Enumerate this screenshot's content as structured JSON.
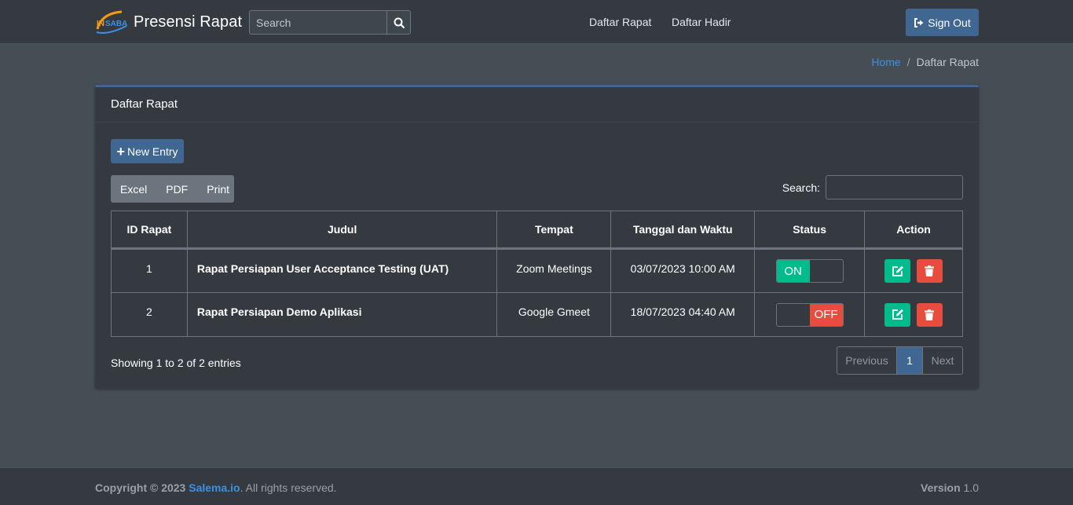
{
  "navbar": {
    "brand_logo_text": "INSABA",
    "brand_title": "Presensi Rapat",
    "search_placeholder": "Search",
    "links": [
      "Daftar Rapat",
      "Daftar Hadir"
    ],
    "signout_label": "Sign Out"
  },
  "breadcrumb": {
    "home": "Home",
    "separator": "/",
    "current": "Daftar Rapat"
  },
  "card": {
    "title": "Daftar Rapat",
    "new_entry_label": "New Entry",
    "export_buttons": [
      "Excel",
      "PDF",
      "Print"
    ],
    "search_label": "Search:",
    "search_value": ""
  },
  "table": {
    "headers": [
      "ID Rapat",
      "Judul",
      "Tempat",
      "Tanggal dan Waktu",
      "Status",
      "Action"
    ],
    "rows": [
      {
        "id": "1",
        "judul": "Rapat Persiapan User Acceptance Testing (UAT)",
        "tempat": "Zoom Meetings",
        "tanggal": "03/07/2023 10:00 AM",
        "status": "ON"
      },
      {
        "id": "2",
        "judul": "Rapat Persiapan Demo Aplikasi",
        "tempat": "Google Gmeet",
        "tanggal": "18/07/2023 04:40 AM",
        "status": "OFF"
      }
    ]
  },
  "info": {
    "showing": "Showing 1 to 2 of 2 entries"
  },
  "pagination": {
    "previous": "Previous",
    "current": "1",
    "next": "Next"
  },
  "footer": {
    "copyright_prefix": "Copyright © 2023",
    "link": "Salema.io",
    "suffix": ". All rights reserved.",
    "version_label": "Version",
    "version_value": "1.0"
  },
  "colors": {
    "primary": "#3f6791",
    "success": "#00bc8c",
    "danger": "#e74c3c",
    "link": "#3f8fe3"
  }
}
